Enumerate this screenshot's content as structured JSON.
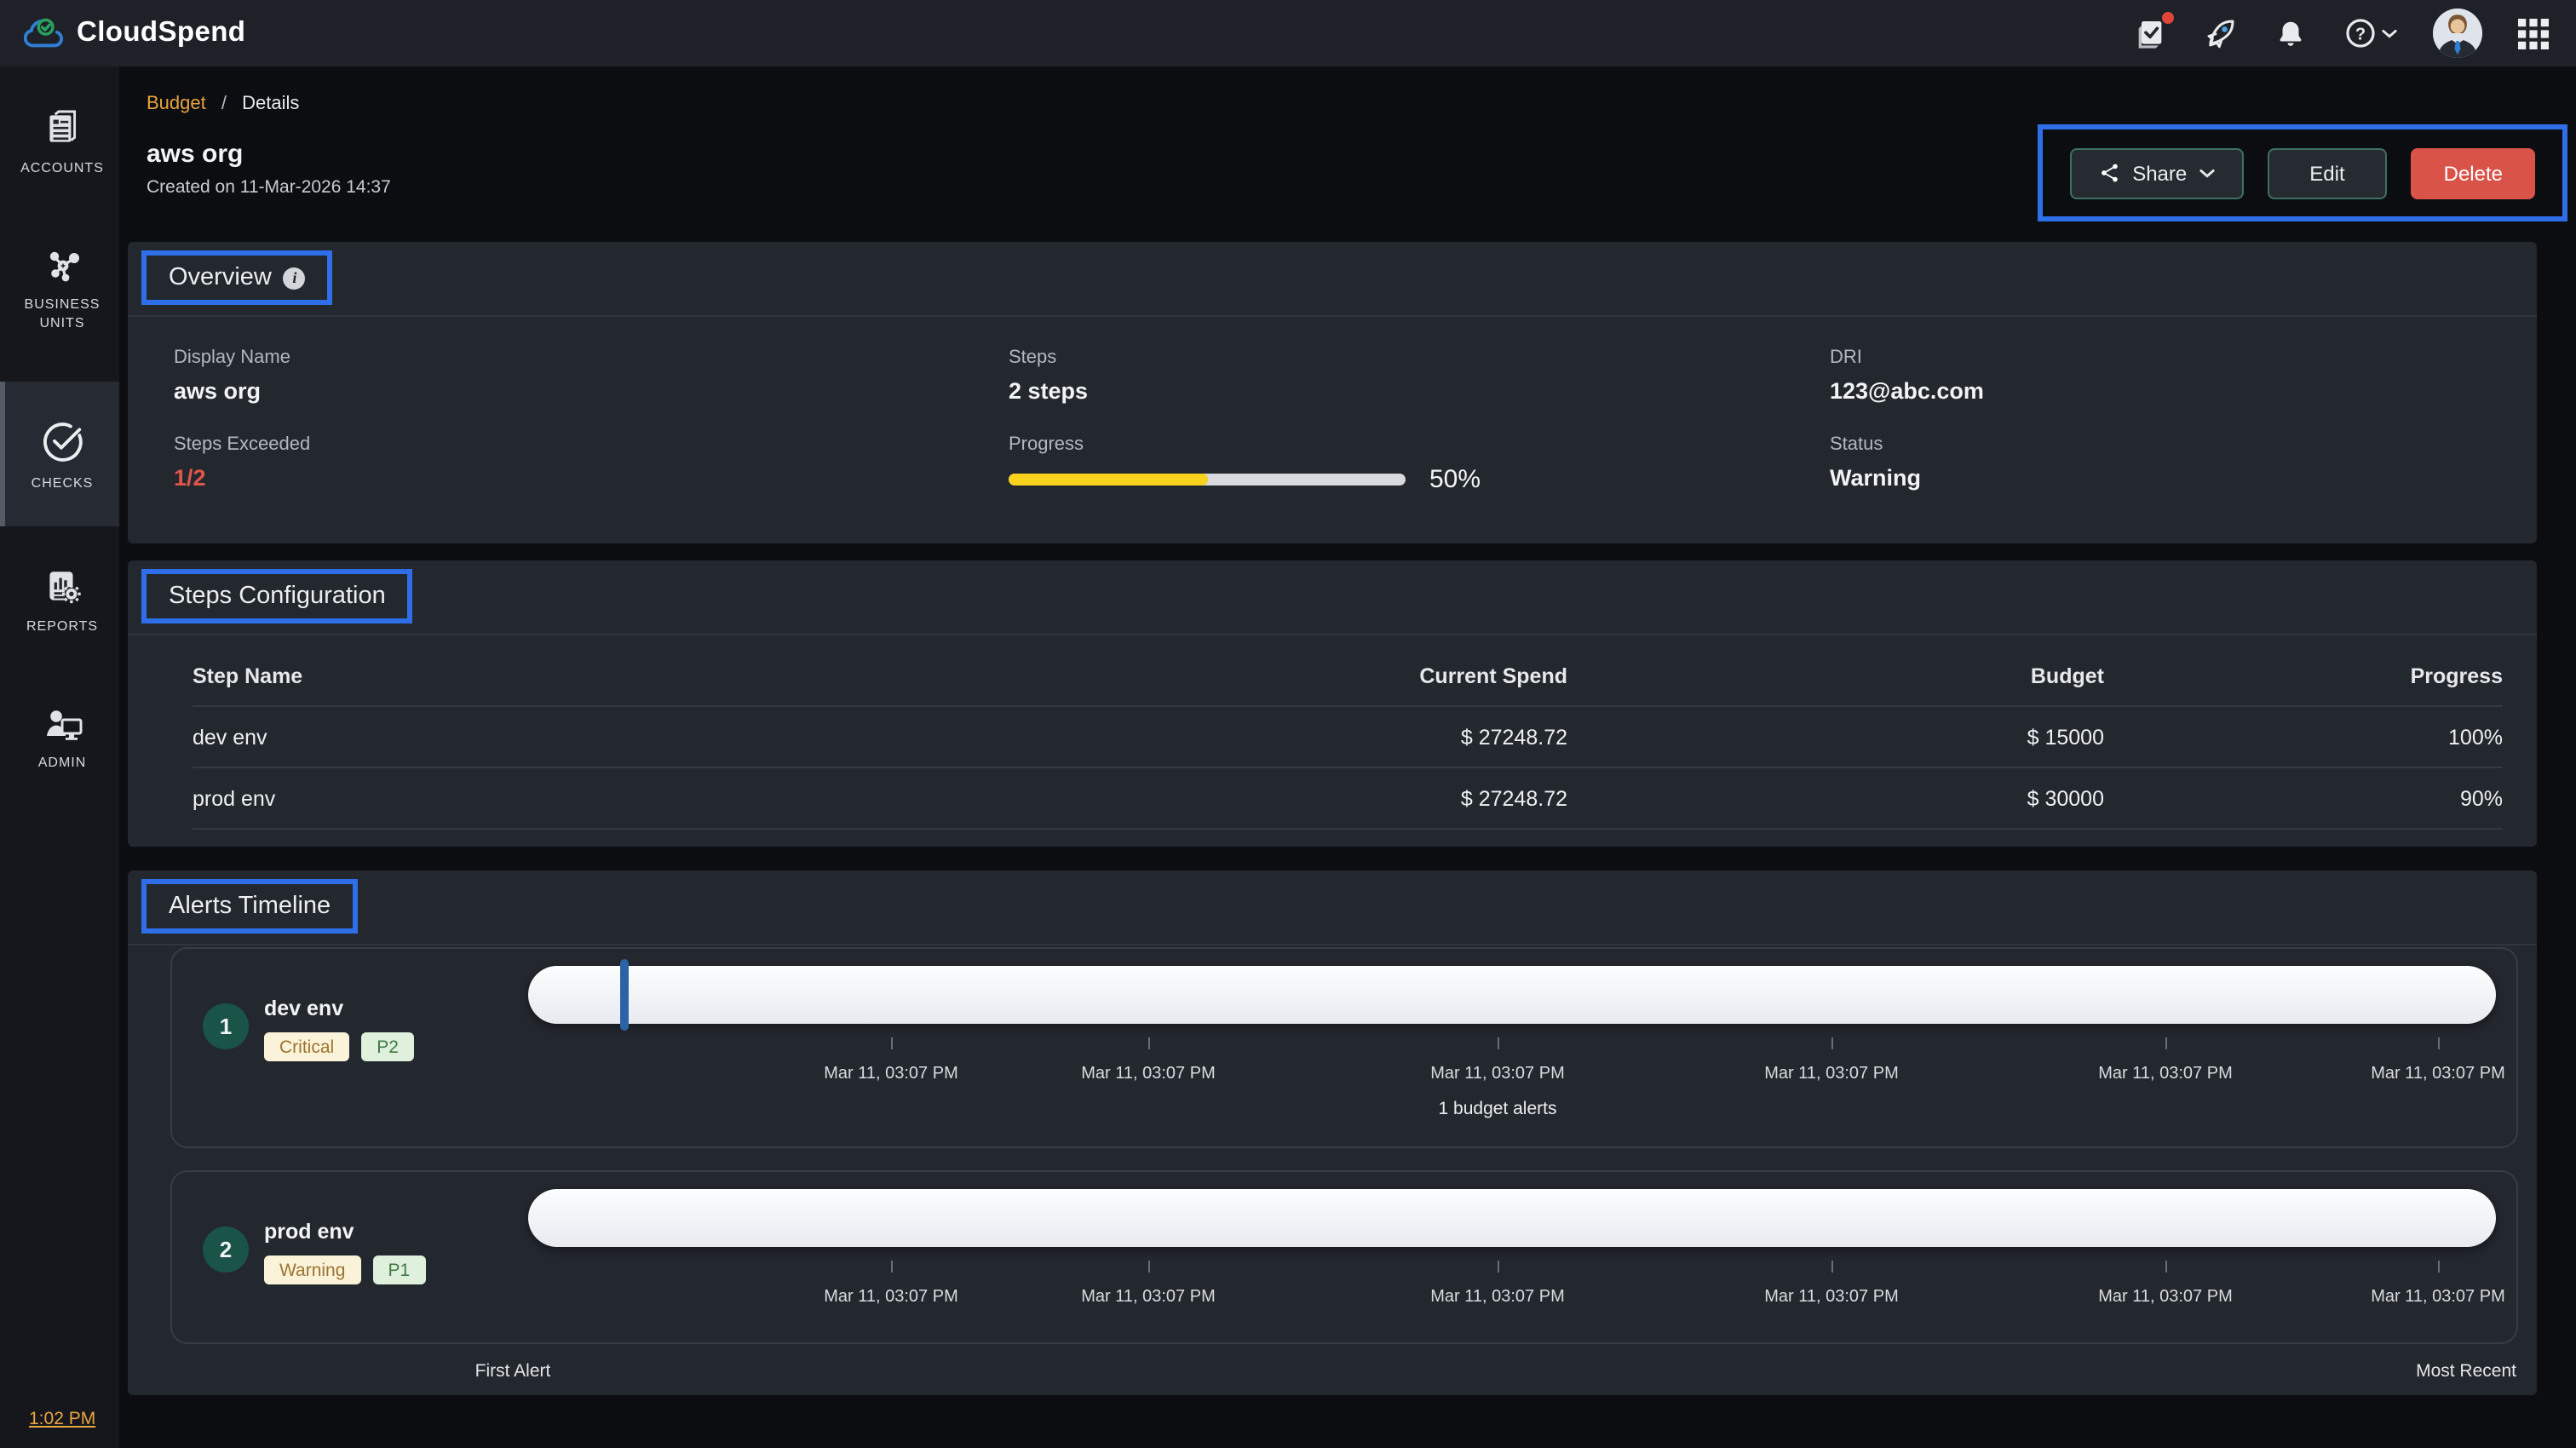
{
  "topbar": {
    "brand": "CloudSpend"
  },
  "breadcrumb": {
    "section": "Budget",
    "separator": "/",
    "current": "Details"
  },
  "sidebar": {
    "items": [
      {
        "id": "accounts",
        "label": "ACCOUNTS",
        "icon": "documents-icon"
      },
      {
        "id": "business-units",
        "label": "BUSINESS UNITS",
        "icon": "network-icon"
      },
      {
        "id": "checks",
        "label": "CHECKS",
        "icon": "check-circle-icon",
        "active": true
      },
      {
        "id": "reports",
        "label": "REPORTS",
        "icon": "report-gear-icon"
      },
      {
        "id": "admin",
        "label": "ADMIN",
        "icon": "person-monitor-icon"
      }
    ],
    "clock": "1:02 PM"
  },
  "page": {
    "title": "aws org",
    "created": "Created on 11-Mar-2026 14:37"
  },
  "actions": {
    "share": "Share",
    "edit": "Edit",
    "delete": "Delete"
  },
  "overview": {
    "title": "Overview",
    "fields": {
      "display_name": {
        "label": "Display Name",
        "value": "aws org"
      },
      "steps": {
        "label": "Steps",
        "value": "2 steps"
      },
      "dri": {
        "label": "DRI",
        "value": "123@abc.com"
      },
      "steps_exceeded": {
        "label": "Steps Exceeded",
        "value": "1/2"
      },
      "progress": {
        "label": "Progress",
        "percent": 50,
        "percent_label": "50%"
      },
      "status": {
        "label": "Status",
        "value": "Warning"
      }
    }
  },
  "steps_config": {
    "title": "Steps Configuration",
    "columns": [
      "Step Name",
      "Current Spend",
      "Budget",
      "Progress"
    ],
    "rows": [
      {
        "name": "dev env",
        "current_spend": "$ 27248.72",
        "budget": "$ 15000",
        "progress": "100%",
        "exceeded": true
      },
      {
        "name": "prod env",
        "current_spend": "$ 27248.72",
        "budget": "$ 30000",
        "progress": "90%",
        "exceeded": false
      }
    ]
  },
  "alerts_timeline": {
    "title": "Alerts Timeline",
    "rows": [
      {
        "index": "1",
        "name": "dev env",
        "severity": "Critical",
        "priority": "P2",
        "has_marker": true,
        "annotation": "1 budget alerts",
        "timestamps": [
          "Mar 11, 03:07 PM",
          "Mar 11, 03:07 PM",
          "Mar 11, 03:07 PM",
          "Mar 11, 03:07 PM",
          "Mar 11, 03:07 PM",
          "Mar 11, 03:07 PM"
        ]
      },
      {
        "index": "2",
        "name": "prod env",
        "severity": "Warning",
        "priority": "P1",
        "has_marker": false,
        "timestamps": [
          "Mar 11, 03:07 PM",
          "Mar 11, 03:07 PM",
          "Mar 11, 03:07 PM",
          "Mar 11, 03:07 PM",
          "Mar 11, 03:07 PM",
          "Mar 11, 03:07 PM"
        ]
      }
    ],
    "footer": {
      "left": "First Alert",
      "right": "Most Recent"
    }
  },
  "colors": {
    "accent_blue": "#2e6ee9",
    "danger_red": "#da5349",
    "exceeded_red": "#e2574c",
    "progress_yellow": "#f8d21c",
    "badge_severity_bg": "#fbf3d9",
    "badge_severity_text": "#9c7430",
    "badge_priority_bg": "#dff0dc",
    "badge_priority_text": "#417a46",
    "timeline_marker_blue": "#2b63a6",
    "step_circle_teal": "#1a5348",
    "link_orange": "#e8a33d"
  }
}
